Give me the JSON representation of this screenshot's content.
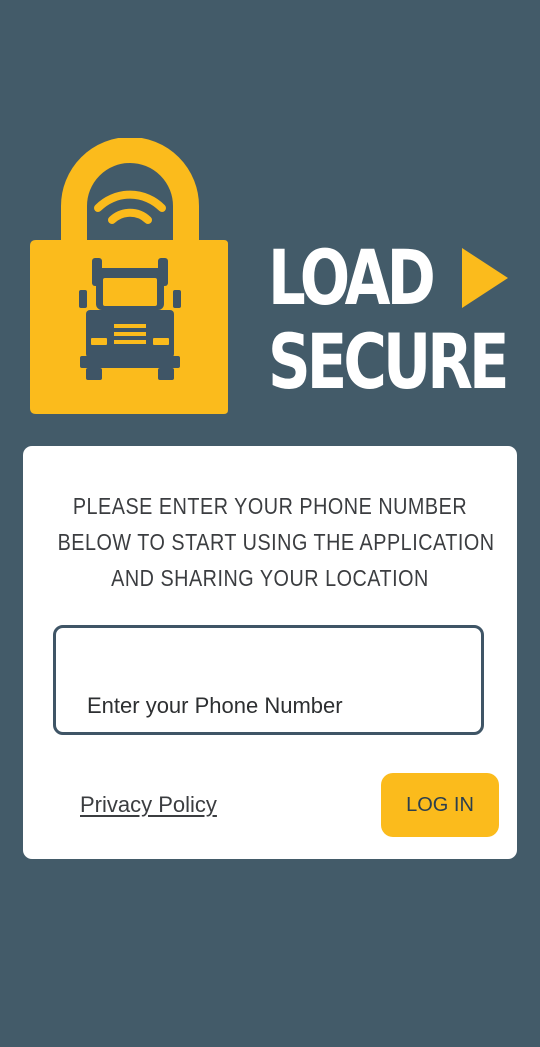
{
  "brand": {
    "line1": "LOAD",
    "line2": "SECURE",
    "logo_icon": "padlock-truck-icon",
    "arrow_icon": "play-arrow-icon"
  },
  "form": {
    "instruction_lines": [
      "PLEASE ENTER YOUR PHONE NUMBER",
      "BELOW TO START USING THE APPLICATION",
      "AND SHARING YOUR LOCATION"
    ],
    "phone_placeholder": "Enter your Phone Number",
    "phone_value": "",
    "privacy_label": "Privacy Policy",
    "login_label": "LOG IN"
  },
  "colors": {
    "background": "#435b69",
    "accent": "#fbbb1c",
    "card": "#ffffff",
    "input_border": "#3f5566"
  }
}
